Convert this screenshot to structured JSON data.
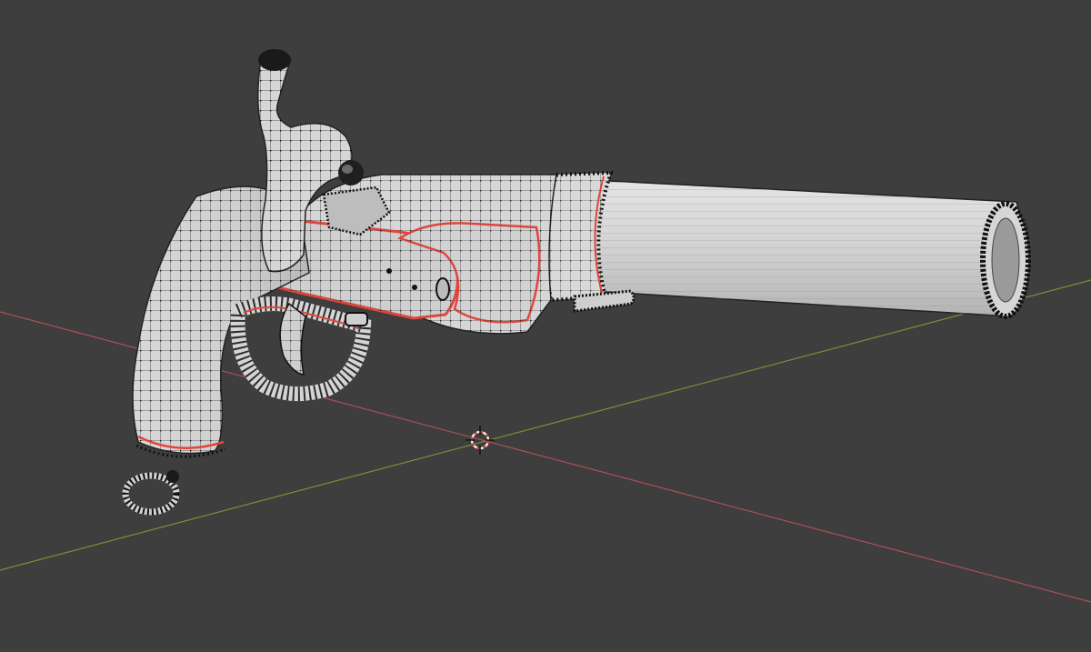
{
  "viewport": {
    "background_color": "#3e3e3e",
    "view_mode": "edit-mode-wireframe-overlay"
  },
  "axes": {
    "x_axis_color": "#b8525a",
    "y_axis_color": "#7c9a3a"
  },
  "mesh": {
    "object": "flintlock-pistol",
    "face_color": "#dcdcdc",
    "edge_color": "#1a1a1a",
    "seam_color": "#e0463c",
    "vertex_color": "#111111"
  },
  "cursor_3d": {
    "icon": "3d-cursor-icon",
    "ring_color_a": "#d04040",
    "ring_color_b": "#f0f0f0"
  }
}
